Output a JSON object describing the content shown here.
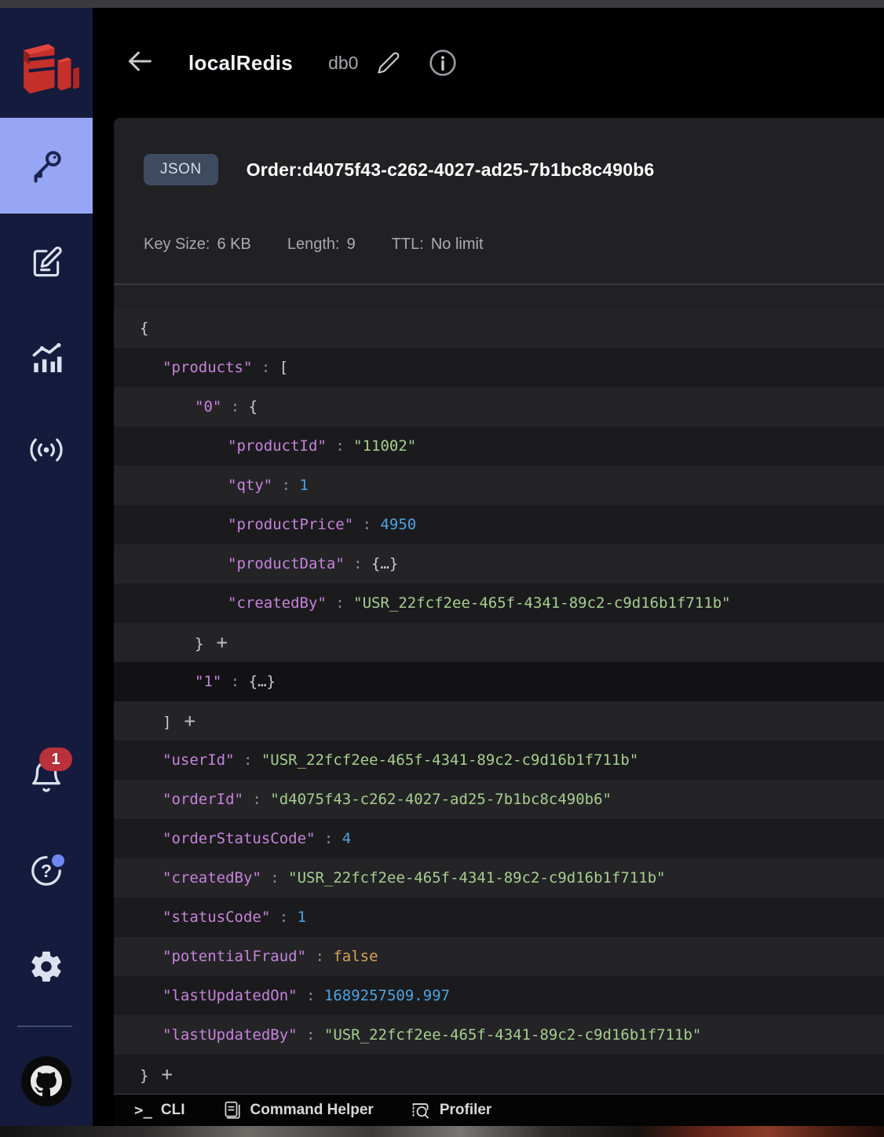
{
  "header": {
    "connection_name": "localRedis",
    "db_label": "db0"
  },
  "sidebar": {
    "selected_item": "browser",
    "notification_count": "1"
  },
  "key_view": {
    "type_badge": "JSON",
    "key_name": "Order:d4075f43-c262-4027-ad25-7b1bc8c490b6",
    "meta": {
      "key_size_label": "Key Size:",
      "key_size_value": "6 KB",
      "length_label": "Length:",
      "length_value": "9",
      "ttl_label": "TTL:",
      "ttl_value": "No limit"
    }
  },
  "json_tree": {
    "indents": [
      33,
      62,
      103,
      145
    ],
    "rows": [
      {
        "level": 0,
        "value": "{",
        "type": "bracket"
      },
      {
        "level": 1,
        "key": "products",
        "value": "[",
        "type": "bracket"
      },
      {
        "level": 2,
        "key": "0",
        "value": "{",
        "type": "bracket"
      },
      {
        "level": 3,
        "key": "productId",
        "value": "\"11002\"",
        "type": "string"
      },
      {
        "level": 3,
        "key": "qty",
        "value": "1",
        "type": "number"
      },
      {
        "level": 3,
        "key": "productPrice",
        "value": "4950",
        "type": "number"
      },
      {
        "level": 3,
        "key": "productData",
        "value": "{…}",
        "type": "collapsed"
      },
      {
        "level": 3,
        "key": "createdBy",
        "value": "\"USR_22fcf2ee-465f-4341-89c2-c9d16b1f711b\"",
        "type": "string"
      },
      {
        "level": 2,
        "value": "}",
        "type": "bracket",
        "plus": true
      },
      {
        "level": 2,
        "key": "1",
        "value": "{…}",
        "type": "collapsed",
        "shade": "dark"
      },
      {
        "level": 1,
        "value": "]",
        "type": "bracket",
        "plus": true
      },
      {
        "level": 1,
        "key": "userId",
        "value": "\"USR_22fcf2ee-465f-4341-89c2-c9d16b1f711b\"",
        "type": "string"
      },
      {
        "level": 1,
        "key": "orderId",
        "value": "\"d4075f43-c262-4027-ad25-7b1bc8c490b6\"",
        "type": "string"
      },
      {
        "level": 1,
        "key": "orderStatusCode",
        "value": "4",
        "type": "number"
      },
      {
        "level": 1,
        "key": "createdBy",
        "value": "\"USR_22fcf2ee-465f-4341-89c2-c9d16b1f711b\"",
        "type": "string"
      },
      {
        "level": 1,
        "key": "statusCode",
        "value": "1",
        "type": "number"
      },
      {
        "level": 1,
        "key": "potentialFraud",
        "value": "false",
        "type": "boolean"
      },
      {
        "level": 1,
        "key": "lastUpdatedOn",
        "value": "1689257509.997",
        "type": "number"
      },
      {
        "level": 1,
        "key": "lastUpdatedBy",
        "value": "\"USR_22fcf2ee-465f-4341-89c2-c9d16b1f711b\"",
        "type": "string"
      },
      {
        "level": 0,
        "value": "}",
        "type": "bracket",
        "plus": true
      }
    ]
  },
  "bottom_bar": {
    "items": [
      {
        "id": "cli",
        "label": "CLI"
      },
      {
        "id": "command-helper",
        "label": "Command Helper"
      },
      {
        "id": "profiler",
        "label": "Profiler"
      }
    ]
  },
  "colors": {
    "sidebar_bg": "#151b3c",
    "selected_item_bg": "#97a6f4",
    "notification_badge_red": "#b8313c",
    "notification_dot_blue": "#6d87f5",
    "type_badge_bg": "#3e4a5f",
    "json_key": "#c583db",
    "json_string": "#a7ce8f",
    "json_number": "#4fa2e0",
    "json_boolean": "#d2a156",
    "redis_logo_red": "#c6302b"
  }
}
